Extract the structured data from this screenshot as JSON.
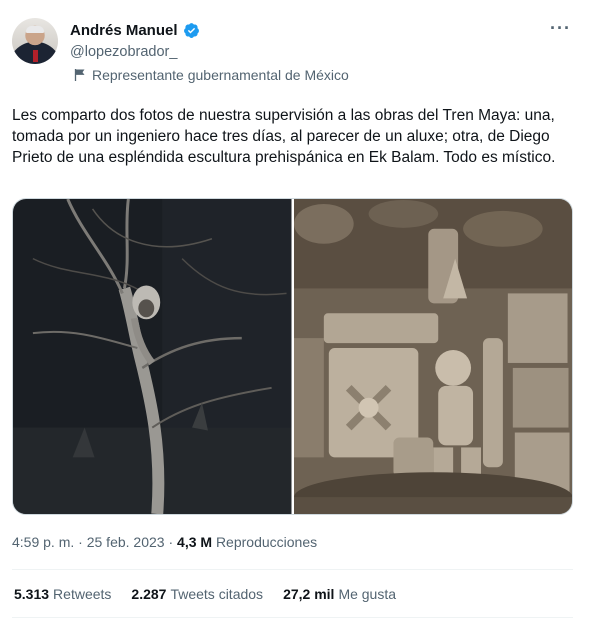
{
  "author": {
    "name": "Andrés Manuel",
    "handle": "@lopezobrador_",
    "label": "Representante gubernamental de México"
  },
  "more_label": "···",
  "tweet": {
    "text": "Les comparto dos fotos de nuestra supervisión a las obras del Tren Maya: una, tomada por un ingeniero hace tres días, al parecer de un aluxe; otra, de Diego Prieto de una espléndida escultura prehispánica en Ek Balam. Todo es místico."
  },
  "meta": {
    "time": "4:59 p. m.",
    "separator": " · ",
    "date": "25 feb. 2023",
    "views_count": "4,3 M",
    "views_label": "Reproducciones"
  },
  "stats": {
    "retweets_count": "5.313",
    "retweets_label": "Retweets",
    "quotes_count": "2.287",
    "quotes_label": "Tweets citados",
    "likes_count": "27,2 mil",
    "likes_label": "Me gusta"
  },
  "icons": {
    "verified": "verified-badge-icon",
    "gov": "flag-icon",
    "more": "more-icon"
  },
  "colors": {
    "verified": "#1d9bf0",
    "secondary_text": "#536471"
  }
}
